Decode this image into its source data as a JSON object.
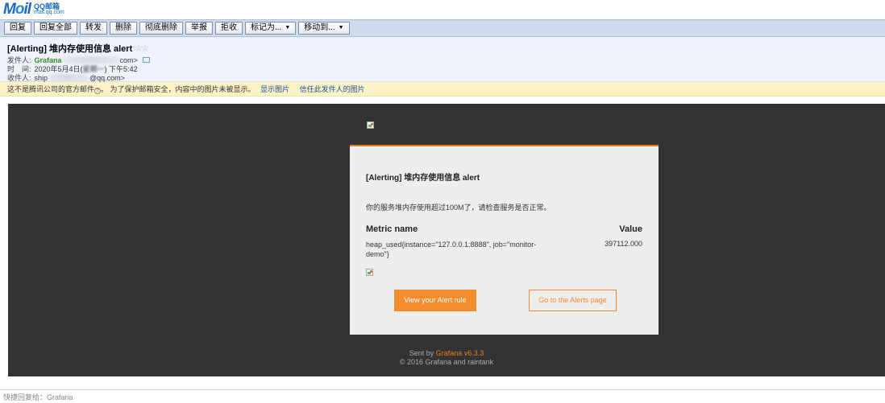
{
  "logo": {
    "main": "Mail",
    "o_letter": "o",
    "cn": "QQ邮箱",
    "domain": "mail.qq.com"
  },
  "toolbar": {
    "buttons": [
      "回复",
      "回复全部",
      "转发",
      "删除",
      "彻底删除",
      "举报",
      "拒收"
    ],
    "dropdowns": [
      "标记为...",
      "移动到..."
    ]
  },
  "header": {
    "subject": "[Alerting] 堆内存使用信息 alert",
    "stars": "☆☆",
    "from_label": "发件人:",
    "from_name": "Grafana",
    "from_email_tail": "com>",
    "time_label": "时　间:",
    "time_value_a": "2020年5月4日(",
    "time_value_blurred": "星期一",
    "time_value_b": ") 下午5:42",
    "to_label": "收件人:",
    "to_name": "ship",
    "to_email_tail": "@qq.com>"
  },
  "warning": {
    "text_a": "这不是腾讯公司的官方邮件",
    "qmark": "?",
    "text_b": "。 为了保护邮箱安全，内容中的图片未被显示。",
    "link_show": "显示图片",
    "link_trust": "信任此发件人的图片"
  },
  "email": {
    "title": "[Alerting] 堆内存使用信息 alert",
    "message": "你的服务堆内存使用超过100M了，请检查服务是否正常。",
    "metric_header": "Metric name",
    "value_header": "Value",
    "metric_name": "heap_used{instance=\"127.0.0.1:8888\", job=\"monitor-demo\"}",
    "metric_value": "397112.000",
    "btn_view": "View your Alert rule",
    "btn_alerts": "Go to the Alerts page",
    "sent_by_prefix": "Sent by ",
    "sent_by_brand": "Grafana v6.3.3",
    "copyright": "© 2016 Grafana and raintank"
  },
  "quick_reply": {
    "placeholder": "快捷回复给：Grafana"
  },
  "colors": {
    "accent": "#eb7b18",
    "body_bg": "#333333",
    "card_bg": "#eeeeee",
    "toolbar_bg": "#cfdcef",
    "warn_bg": "#fbf3c6"
  }
}
